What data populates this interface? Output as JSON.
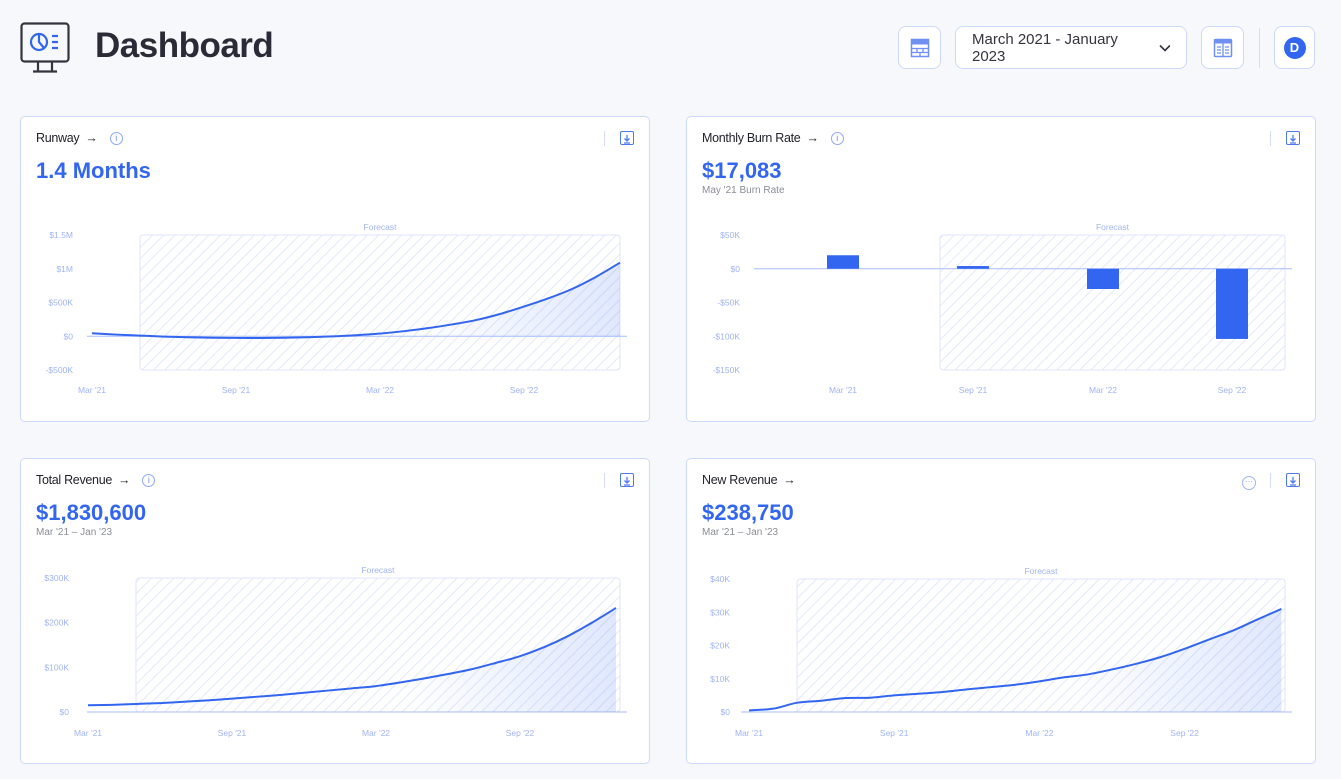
{
  "header": {
    "title": "Dashboard",
    "date_range": "March 2021 - January 2023",
    "avatar_initial": "D",
    "logo_icon": "monitor-chart-icon"
  },
  "colors": {
    "accent": "#3366f0",
    "forecast_hatch": "#e3e9fb"
  },
  "cards": [
    {
      "title": "Runway",
      "value": "1.4 Months",
      "subtitle": "",
      "info": true,
      "chart_data": {
        "type": "line",
        "forecast_label": "Forecast",
        "forecast_from": "May '21",
        "ylim": [
          -500000,
          1500000
        ],
        "yticks": [
          "$1.5M",
          "$1M",
          "$500K",
          "$0",
          "-$500K"
        ],
        "ytick_values": [
          1500000,
          1000000,
          500000,
          0,
          -500000
        ],
        "xticks": [
          "Mar '21",
          "Sep '21",
          "Mar '22",
          "Sep '22"
        ],
        "x": [
          "Mar '21",
          "Apr '21",
          "May '21",
          "Jun '21",
          "Jul '21",
          "Aug '21",
          "Sep '21",
          "Oct '21",
          "Nov '21",
          "Dec '21",
          "Jan '22",
          "Feb '22",
          "Mar '22",
          "Apr '22",
          "May '22",
          "Jun '22",
          "Jul '22",
          "Aug '22",
          "Sep '22",
          "Oct '22",
          "Nov '22",
          "Dec '22",
          "Jan '23"
        ],
        "values": [
          45000,
          25000,
          10000,
          -5000,
          -15000,
          -22000,
          -25000,
          -25000,
          -22000,
          -15000,
          -2000,
          15000,
          40000,
          75000,
          120000,
          175000,
          240000,
          330000,
          440000,
          560000,
          700000,
          880000,
          1090000
        ]
      }
    },
    {
      "title": "Monthly Burn Rate",
      "value": "$17,083",
      "subtitle": "May '21 Burn Rate",
      "info": true,
      "chart_data": {
        "type": "bar",
        "forecast_label": "Forecast",
        "ylim": [
          -150000,
          50000
        ],
        "yticks": [
          "$50K",
          "$0",
          "-$50K",
          "-$100K",
          "-$150K"
        ],
        "ytick_values": [
          50000,
          0,
          -50000,
          -100000,
          -150000
        ],
        "categories": [
          "Mar '21",
          "Sep '21",
          "Mar '22",
          "Sep '22"
        ],
        "values": [
          20000,
          4000,
          -30000,
          -104000
        ]
      }
    },
    {
      "title": "Total Revenue",
      "value": "$1,830,600",
      "subtitle": "Mar '21 – Jan '23",
      "info": true,
      "chart_data": {
        "type": "line",
        "forecast_label": "Forecast",
        "ylim": [
          0,
          300000
        ],
        "yticks": [
          "$300K",
          "$200K",
          "$100K",
          "$0"
        ],
        "ytick_values": [
          300000,
          200000,
          100000,
          0
        ],
        "xticks": [
          "Mar '21",
          "Sep '21",
          "Mar '22",
          "Sep '22"
        ],
        "values": [
          15000,
          16000,
          18000,
          20000,
          23000,
          26000,
          30000,
          34000,
          38000,
          43000,
          48000,
          53000,
          58000,
          66000,
          75000,
          85000,
          96000,
          110000,
          125000,
          145000,
          170000,
          200000,
          233000
        ]
      }
    },
    {
      "title": "New Revenue",
      "value": "$238,750",
      "subtitle": "Mar '21 – Jan '23",
      "info": false,
      "more": true,
      "chart_data": {
        "type": "line",
        "forecast_label": "Forecast",
        "ylim": [
          0,
          40000
        ],
        "yticks": [
          "$40K",
          "$30K",
          "$20K",
          "$10K",
          "$0"
        ],
        "ytick_values": [
          40000,
          30000,
          20000,
          10000,
          0
        ],
        "xticks": [
          "Mar '21",
          "Sep '21",
          "Mar '22",
          "Sep '22"
        ],
        "values": [
          500,
          1000,
          2800,
          3400,
          4200,
          4300,
          5000,
          5500,
          6000,
          6800,
          7500,
          8200,
          9200,
          10400,
          11300,
          12800,
          14500,
          16500,
          19000,
          21800,
          24500,
          27800,
          31000
        ]
      }
    }
  ]
}
